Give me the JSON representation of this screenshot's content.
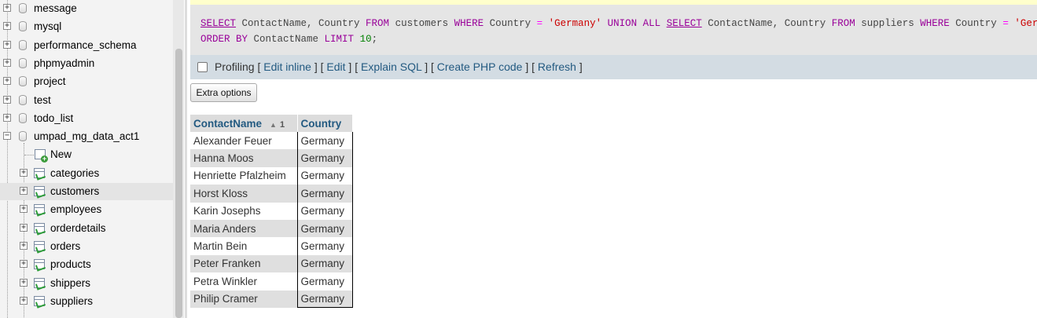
{
  "navigation": {
    "databases": [
      "message",
      "mysql",
      "performance_schema",
      "phpmyadmin",
      "project",
      "test",
      "todo_list",
      "umpad_mg_data_act1"
    ],
    "expanded_db_new_label": "New",
    "tables": [
      "categories",
      "customers",
      "employees",
      "orderdetails",
      "orders",
      "products",
      "shippers",
      "suppliers"
    ],
    "highlighted_table": "customers"
  },
  "sql": {
    "line1": [
      {
        "t": "SELECT",
        "c": "kwu"
      },
      {
        "t": " ContactName, Country ",
        "c": ""
      },
      {
        "t": "FROM",
        "c": "kw"
      },
      {
        "t": " customers ",
        "c": ""
      },
      {
        "t": "WHERE",
        "c": "kw"
      },
      {
        "t": " Country ",
        "c": ""
      },
      {
        "t": "=",
        "c": "op"
      },
      {
        "t": " ",
        "c": ""
      },
      {
        "t": "'Germany'",
        "c": "str"
      },
      {
        "t": " ",
        "c": ""
      },
      {
        "t": "UNION ALL",
        "c": "kw"
      },
      {
        "t": " ",
        "c": ""
      },
      {
        "t": "SELECT",
        "c": "kwu"
      },
      {
        "t": " ContactName, Country ",
        "c": ""
      },
      {
        "t": "FROM",
        "c": "kw"
      },
      {
        "t": " suppliers ",
        "c": ""
      },
      {
        "t": "WHERE",
        "c": "kw"
      },
      {
        "t": " Country ",
        "c": ""
      },
      {
        "t": "=",
        "c": "op"
      },
      {
        "t": " ",
        "c": ""
      },
      {
        "t": "'Germany'",
        "c": "str"
      }
    ],
    "line2": [
      {
        "t": "ORDER BY",
        "c": "kw"
      },
      {
        "t": " ContactName ",
        "c": ""
      },
      {
        "t": "LIMIT",
        "c": "kw"
      },
      {
        "t": " ",
        "c": ""
      },
      {
        "t": "10",
        "c": "num"
      },
      {
        "t": ";",
        "c": ""
      }
    ]
  },
  "toolbar": {
    "profiling_label": "Profiling",
    "profiling_checked": false,
    "links": [
      "Edit inline",
      "Edit",
      "Explain SQL",
      "Create PHP code",
      "Refresh"
    ]
  },
  "extra_options_label": "Extra options",
  "results": {
    "columns": [
      "ContactName",
      "Country"
    ],
    "sort_indicator": "1",
    "rows": [
      [
        "Alexander Feuer",
        "Germany"
      ],
      [
        "Hanna Moos",
        "Germany"
      ],
      [
        "Henriette Pfalzheim",
        "Germany"
      ],
      [
        "Horst Kloss",
        "Germany"
      ],
      [
        "Karin Josephs",
        "Germany"
      ],
      [
        "Maria Anders",
        "Germany"
      ],
      [
        "Martin Bein",
        "Germany"
      ],
      [
        "Peter Franken",
        "Germany"
      ],
      [
        "Petra Winkler",
        "Germany"
      ],
      [
        "Philip Cramer",
        "Germany"
      ]
    ]
  }
}
